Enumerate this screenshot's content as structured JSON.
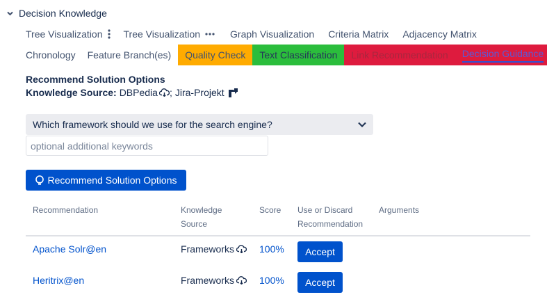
{
  "section": {
    "title": "Decision Knowledge"
  },
  "tabs_row1": [
    {
      "label": "Tree Visualization"
    },
    {
      "label": "Tree Visualization"
    },
    {
      "label": "Graph Visualization"
    },
    {
      "label": "Criteria Matrix"
    },
    {
      "label": "Adjacency Matrix"
    }
  ],
  "tabs_row2": [
    {
      "label": "Chronology"
    },
    {
      "label": "Feature Branch(es)"
    },
    {
      "label": "Quality Check"
    },
    {
      "label": "Text Classification"
    },
    {
      "label": "Link Recommendation"
    },
    {
      "label": "Decision Guidance"
    }
  ],
  "colors": {
    "orange": "#ffab00",
    "green": "#2bbd3c",
    "red": "#de1b3e",
    "primary": "#0052cc"
  },
  "recommend": {
    "heading": "Recommend Solution Options",
    "ks_label": "Knowledge Source:",
    "ks_value1": "DBPedia",
    "ks_sep": ";",
    "ks_value2": "Jira-Projekt"
  },
  "select": {
    "value": "Which framework should we use for the search engine?"
  },
  "keywords": {
    "placeholder": "optional additional keywords"
  },
  "button": {
    "label": "Recommend Solution Options"
  },
  "table": {
    "headers": {
      "recommendation": "Recommendation",
      "ks_line1": "Knowledge",
      "ks_line2": "Source",
      "score": "Score",
      "use_line1": "Use or Discard",
      "use_line2": "Recommendation",
      "arguments": "Arguments"
    },
    "rows": [
      {
        "recommendation": "Apache Solr@en",
        "source": "Frameworks",
        "score": "100%",
        "action": "Accept"
      },
      {
        "recommendation": "Heritrix@en",
        "source": "Frameworks",
        "score": "100%",
        "action": "Accept"
      }
    ]
  },
  "icons": {
    "section": "chevron-down-icon",
    "tree_menu": "vertical-dots-icon",
    "tree_more": "horizontal-dots-icon",
    "select": "chevron-down-icon",
    "dbpedia": "cloud-icon",
    "jira": "jira-icon",
    "button": "lightbulb-icon",
    "source": "cloud-icon"
  }
}
